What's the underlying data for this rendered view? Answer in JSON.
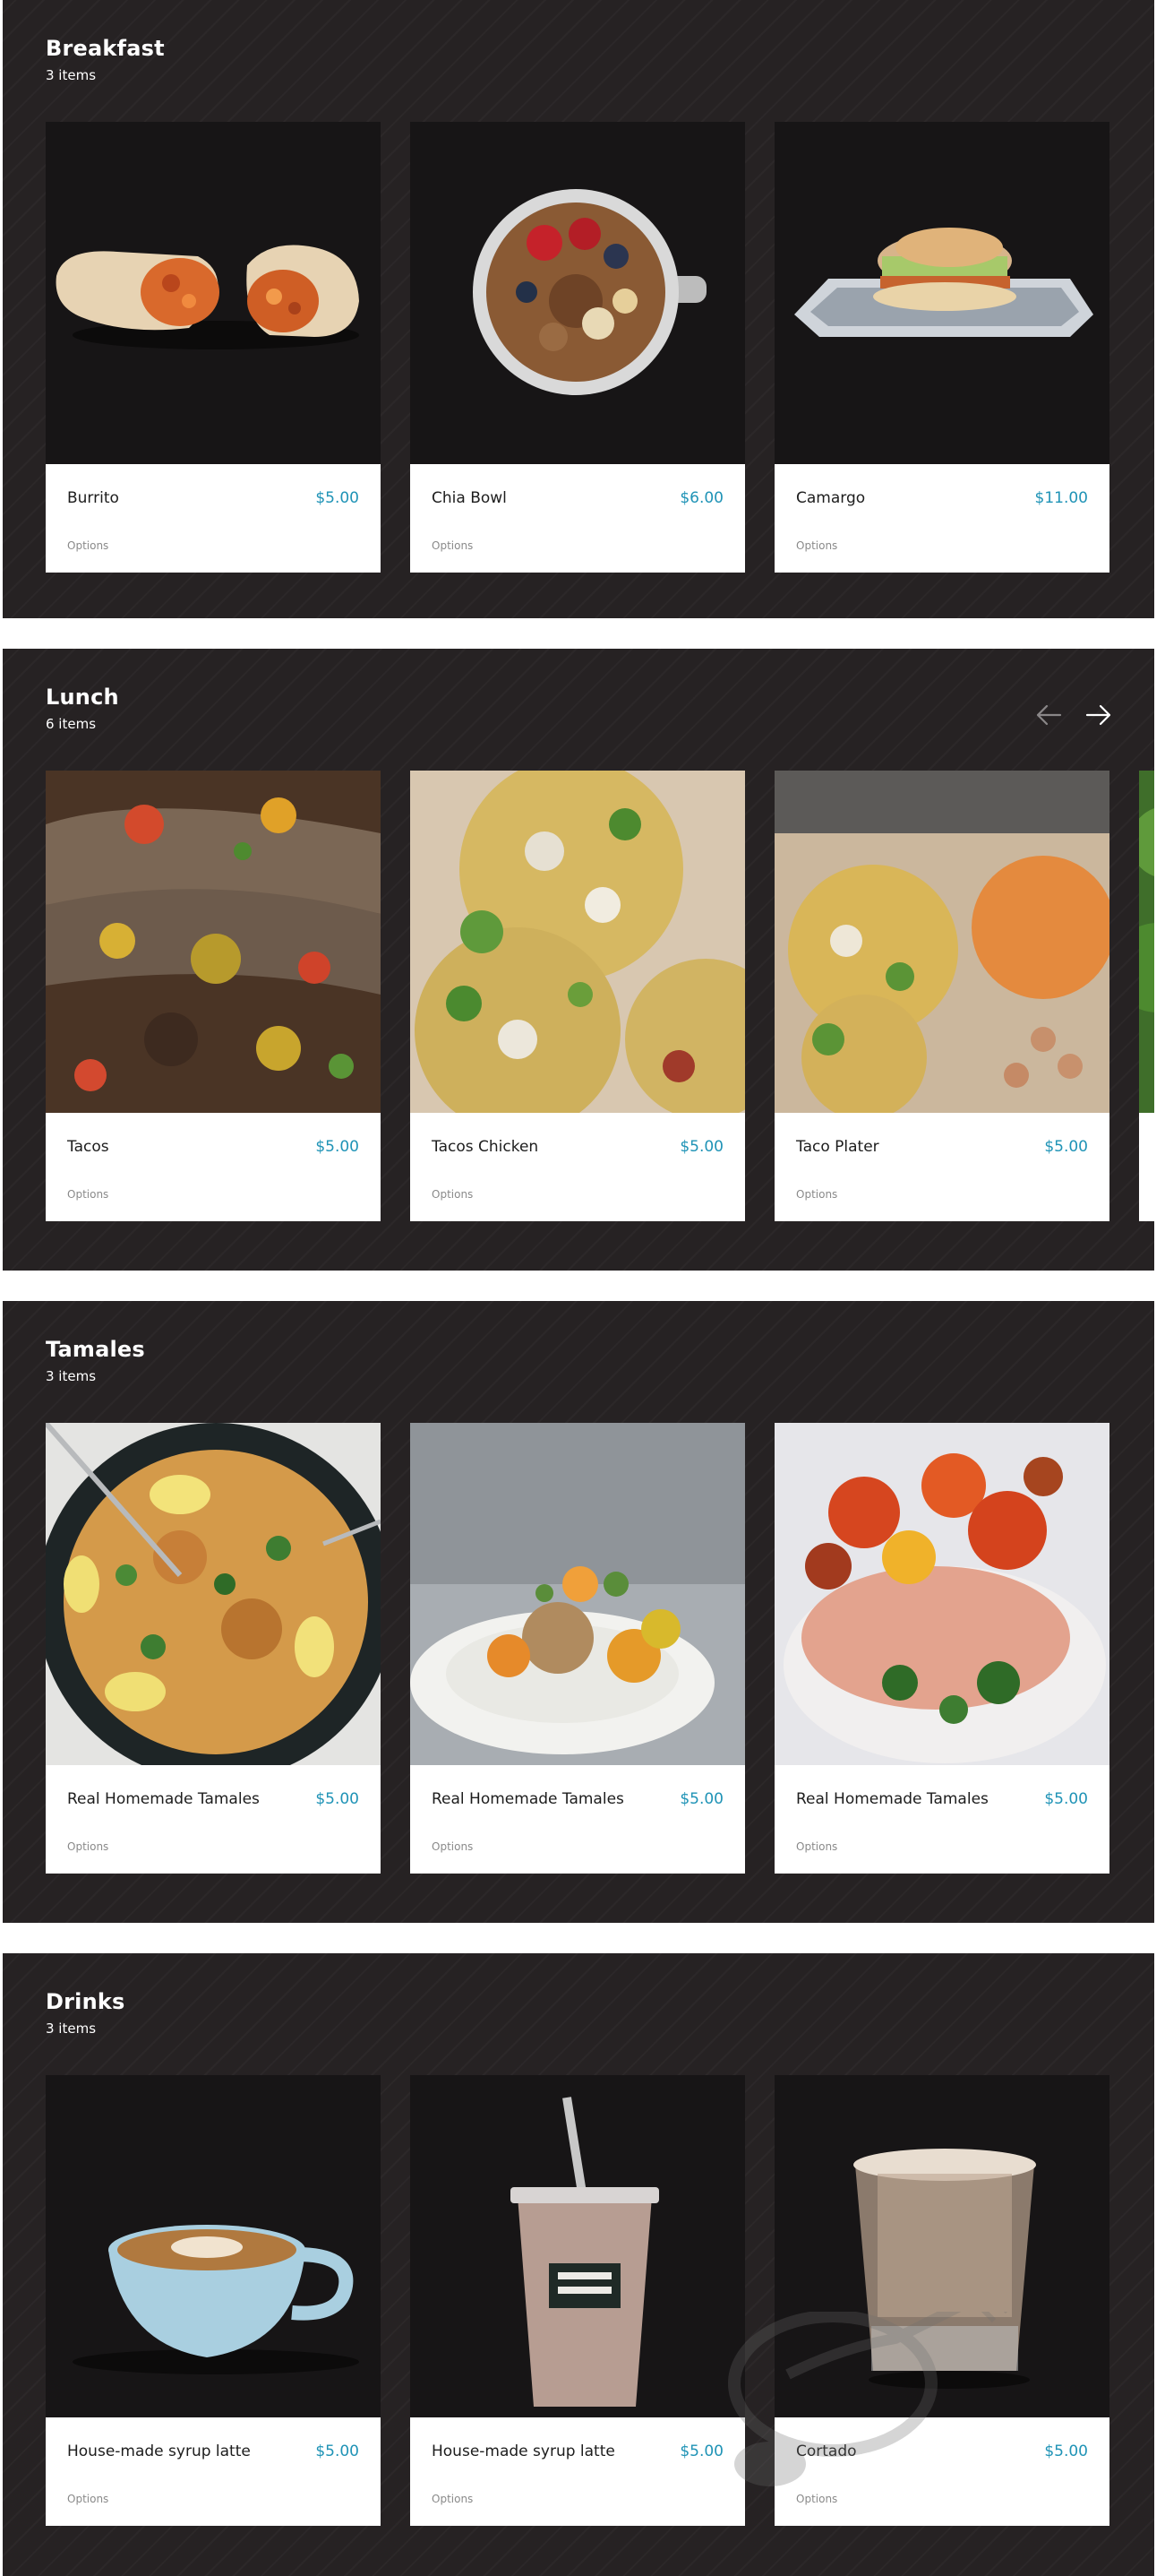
{
  "theme": {
    "section_bg": "#262223",
    "card_bg": "#ffffff",
    "price_color": "#1f93b6",
    "text_color": "#ffffff"
  },
  "sections": [
    {
      "title": "Breakfast",
      "count": "3 items",
      "items": [
        {
          "name": "Burrito",
          "price": "$5.00",
          "options": "Options",
          "image": "burrito-photo"
        },
        {
          "name": "Chia Bowl",
          "price": "$6.00",
          "options": "Options",
          "image": "chia-bowl-photo"
        },
        {
          "name": "Camargo",
          "price": "$11.00",
          "options": "Options",
          "image": "camargo-sandwich-photo"
        }
      ]
    },
    {
      "title": "Lunch",
      "count": "6 items",
      "nav": {
        "prev_icon": "arrow-left-icon",
        "next_icon": "arrow-right-icon"
      },
      "items": [
        {
          "name": "Tacos",
          "price": "$5.00",
          "options": "Options",
          "image": "tacos-photo"
        },
        {
          "name": "Tacos Chicken",
          "price": "$5.00",
          "options": "Options",
          "image": "tacos-chicken-photo"
        },
        {
          "name": "Taco Plater",
          "price": "$5.00",
          "options": "Options",
          "image": "taco-plater-photo"
        }
      ]
    },
    {
      "title": "Tamales",
      "count": "3 items",
      "items": [
        {
          "name": "Real Homemade Tamales",
          "price": "$5.00",
          "options": "Options",
          "image": "paella-plate-photo"
        },
        {
          "name": "Real Homemade Tamales",
          "price": "$5.00",
          "options": "Options",
          "image": "plated-dish-photo"
        },
        {
          "name": "Real Homemade Tamales",
          "price": "$5.00",
          "options": "Options",
          "image": "salmon-tomato-photo"
        }
      ]
    },
    {
      "title": "Drinks",
      "count": "3 items",
      "items": [
        {
          "name": "House-made syrup latte",
          "price": "$5.00",
          "options": "Options",
          "image": "latte-cup-photo"
        },
        {
          "name": "House-made syrup latte",
          "price": "$5.00",
          "options": "Options",
          "image": "iced-latte-photo"
        },
        {
          "name": "Cortado",
          "price": "$5.00",
          "options": "Options",
          "image": "cortado-glass-photo"
        }
      ]
    }
  ],
  "watermark": {
    "text": "sirved"
  }
}
